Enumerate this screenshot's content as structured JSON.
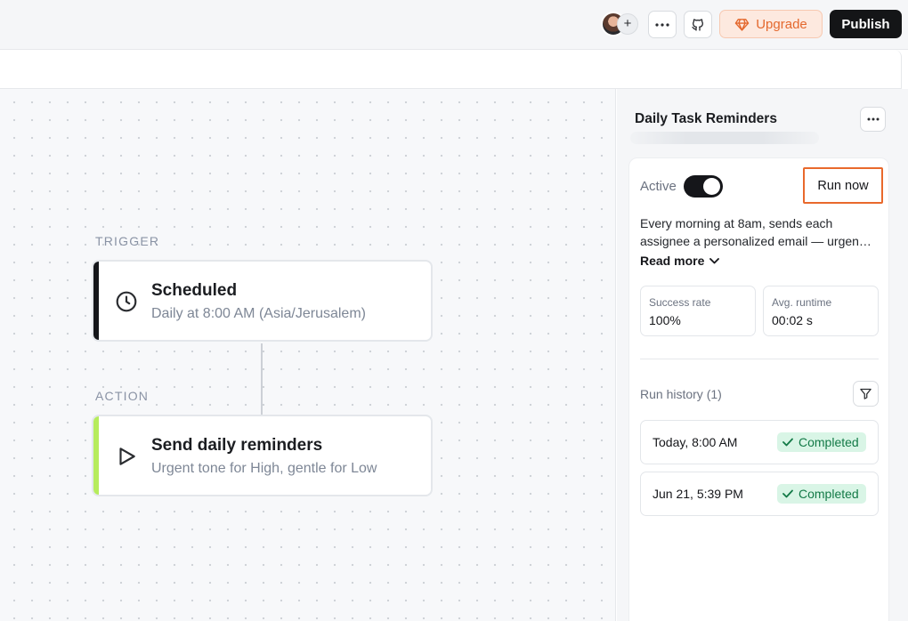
{
  "topbar": {
    "add_collaborator": "+",
    "upgrade_label": "Upgrade",
    "publish_label": "Publish"
  },
  "canvas": {
    "trigger_section": "TRIGGER",
    "action_section": "ACTION",
    "trigger_node": {
      "title": "Scheduled",
      "subtitle": "Daily at 8:00 AM (Asia/Jerusalem)",
      "accent_color": "#15161a",
      "icon": "clock-icon"
    },
    "action_node": {
      "title": "Send daily reminders",
      "subtitle": "Urgent tone for High, gentle for Low",
      "accent_color": "#b6ec5c",
      "icon": "play-icon"
    }
  },
  "panel": {
    "title": "Daily Task Reminders",
    "active_label": "Active",
    "active": true,
    "run_now_label": "Run now",
    "description_line1": "Every morning at 8am, sends each",
    "description_line2": "assignee a personalized email — urgen…",
    "read_more_label": "Read more",
    "stats": [
      {
        "label": "Success rate",
        "value": "100%"
      },
      {
        "label": "Avg. runtime",
        "value": "00:02 s"
      }
    ],
    "history_label": "Run history (1)",
    "runs": [
      {
        "time": "Today, 8:00 AM",
        "status": "Completed"
      },
      {
        "time": "Jun 21, 5:39 PM",
        "status": "Completed"
      }
    ]
  },
  "colors": {
    "accent_orange": "#e9692c",
    "success_green": "#137a47",
    "success_bg": "#d9f5e6"
  }
}
